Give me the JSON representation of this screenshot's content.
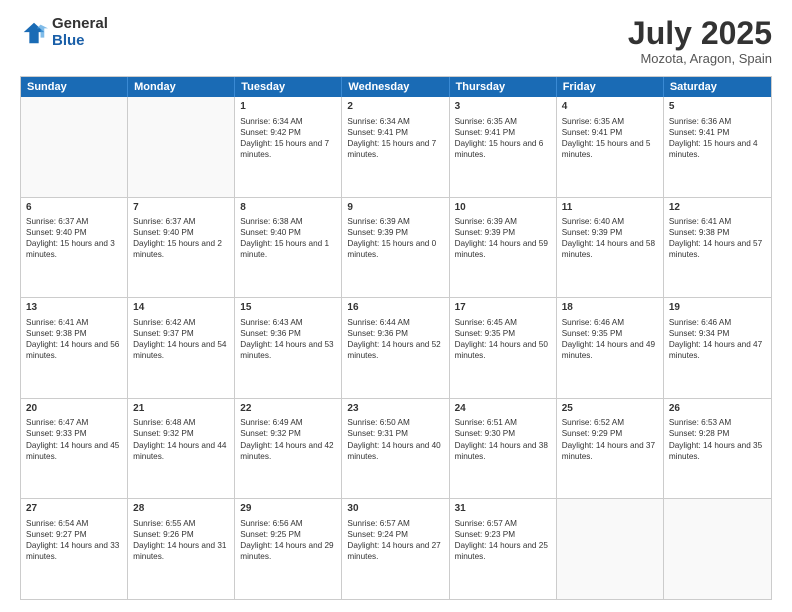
{
  "logo": {
    "general": "General",
    "blue": "Blue"
  },
  "header": {
    "title": "July 2025",
    "subtitle": "Mozota, Aragon, Spain"
  },
  "days": [
    "Sunday",
    "Monday",
    "Tuesday",
    "Wednesday",
    "Thursday",
    "Friday",
    "Saturday"
  ],
  "weeks": [
    [
      {
        "day": "",
        "content": ""
      },
      {
        "day": "",
        "content": ""
      },
      {
        "day": "1",
        "content": "Sunrise: 6:34 AM\nSunset: 9:42 PM\nDaylight: 15 hours and 7 minutes."
      },
      {
        "day": "2",
        "content": "Sunrise: 6:34 AM\nSunset: 9:41 PM\nDaylight: 15 hours and 7 minutes."
      },
      {
        "day": "3",
        "content": "Sunrise: 6:35 AM\nSunset: 9:41 PM\nDaylight: 15 hours and 6 minutes."
      },
      {
        "day": "4",
        "content": "Sunrise: 6:35 AM\nSunset: 9:41 PM\nDaylight: 15 hours and 5 minutes."
      },
      {
        "day": "5",
        "content": "Sunrise: 6:36 AM\nSunset: 9:41 PM\nDaylight: 15 hours and 4 minutes."
      }
    ],
    [
      {
        "day": "6",
        "content": "Sunrise: 6:37 AM\nSunset: 9:40 PM\nDaylight: 15 hours and 3 minutes."
      },
      {
        "day": "7",
        "content": "Sunrise: 6:37 AM\nSunset: 9:40 PM\nDaylight: 15 hours and 2 minutes."
      },
      {
        "day": "8",
        "content": "Sunrise: 6:38 AM\nSunset: 9:40 PM\nDaylight: 15 hours and 1 minute."
      },
      {
        "day": "9",
        "content": "Sunrise: 6:39 AM\nSunset: 9:39 PM\nDaylight: 15 hours and 0 minutes."
      },
      {
        "day": "10",
        "content": "Sunrise: 6:39 AM\nSunset: 9:39 PM\nDaylight: 14 hours and 59 minutes."
      },
      {
        "day": "11",
        "content": "Sunrise: 6:40 AM\nSunset: 9:39 PM\nDaylight: 14 hours and 58 minutes."
      },
      {
        "day": "12",
        "content": "Sunrise: 6:41 AM\nSunset: 9:38 PM\nDaylight: 14 hours and 57 minutes."
      }
    ],
    [
      {
        "day": "13",
        "content": "Sunrise: 6:41 AM\nSunset: 9:38 PM\nDaylight: 14 hours and 56 minutes."
      },
      {
        "day": "14",
        "content": "Sunrise: 6:42 AM\nSunset: 9:37 PM\nDaylight: 14 hours and 54 minutes."
      },
      {
        "day": "15",
        "content": "Sunrise: 6:43 AM\nSunset: 9:36 PM\nDaylight: 14 hours and 53 minutes."
      },
      {
        "day": "16",
        "content": "Sunrise: 6:44 AM\nSunset: 9:36 PM\nDaylight: 14 hours and 52 minutes."
      },
      {
        "day": "17",
        "content": "Sunrise: 6:45 AM\nSunset: 9:35 PM\nDaylight: 14 hours and 50 minutes."
      },
      {
        "day": "18",
        "content": "Sunrise: 6:46 AM\nSunset: 9:35 PM\nDaylight: 14 hours and 49 minutes."
      },
      {
        "day": "19",
        "content": "Sunrise: 6:46 AM\nSunset: 9:34 PM\nDaylight: 14 hours and 47 minutes."
      }
    ],
    [
      {
        "day": "20",
        "content": "Sunrise: 6:47 AM\nSunset: 9:33 PM\nDaylight: 14 hours and 45 minutes."
      },
      {
        "day": "21",
        "content": "Sunrise: 6:48 AM\nSunset: 9:32 PM\nDaylight: 14 hours and 44 minutes."
      },
      {
        "day": "22",
        "content": "Sunrise: 6:49 AM\nSunset: 9:32 PM\nDaylight: 14 hours and 42 minutes."
      },
      {
        "day": "23",
        "content": "Sunrise: 6:50 AM\nSunset: 9:31 PM\nDaylight: 14 hours and 40 minutes."
      },
      {
        "day": "24",
        "content": "Sunrise: 6:51 AM\nSunset: 9:30 PM\nDaylight: 14 hours and 38 minutes."
      },
      {
        "day": "25",
        "content": "Sunrise: 6:52 AM\nSunset: 9:29 PM\nDaylight: 14 hours and 37 minutes."
      },
      {
        "day": "26",
        "content": "Sunrise: 6:53 AM\nSunset: 9:28 PM\nDaylight: 14 hours and 35 minutes."
      }
    ],
    [
      {
        "day": "27",
        "content": "Sunrise: 6:54 AM\nSunset: 9:27 PM\nDaylight: 14 hours and 33 minutes."
      },
      {
        "day": "28",
        "content": "Sunrise: 6:55 AM\nSunset: 9:26 PM\nDaylight: 14 hours and 31 minutes."
      },
      {
        "day": "29",
        "content": "Sunrise: 6:56 AM\nSunset: 9:25 PM\nDaylight: 14 hours and 29 minutes."
      },
      {
        "day": "30",
        "content": "Sunrise: 6:57 AM\nSunset: 9:24 PM\nDaylight: 14 hours and 27 minutes."
      },
      {
        "day": "31",
        "content": "Sunrise: 6:57 AM\nSunset: 9:23 PM\nDaylight: 14 hours and 25 minutes."
      },
      {
        "day": "",
        "content": ""
      },
      {
        "day": "",
        "content": ""
      }
    ]
  ]
}
